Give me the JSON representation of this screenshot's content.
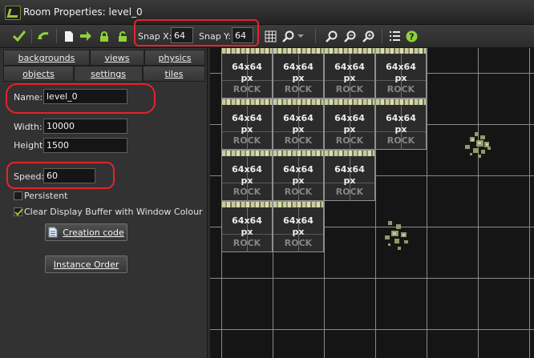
{
  "window": {
    "title": "Room Properties: level_0"
  },
  "toolbar": {
    "snap_x_label": "Snap X:",
    "snap_x_value": "64",
    "snap_y_label": "Snap Y:",
    "snap_y_value": "64"
  },
  "tabs": [
    {
      "label": "backgrounds"
    },
    {
      "label": "views"
    },
    {
      "label": "physics"
    },
    {
      "label": "objects"
    },
    {
      "label": "settings",
      "active": true
    },
    {
      "label": "tiles"
    }
  ],
  "settings": {
    "name_label": "Name:",
    "name_value": "level_0",
    "width_label": "Width:",
    "width_value": "10000",
    "height_label": "Height:",
    "height_value": "1500",
    "speed_label": "Speed:",
    "speed_value": "60",
    "persistent_label": "Persistent",
    "persistent_checked": false,
    "clear_display_label": "Clear Display Buffer with Window Colour",
    "clear_display_checked": true,
    "creation_code_label": "Creation code",
    "instance_order_label": "Instance Order"
  },
  "tile_label": {
    "line1": "64x64",
    "line2": "px",
    "line3": "ROCK"
  },
  "tile_rows": [
    4,
    4,
    3,
    2
  ],
  "colors": {
    "highlight": "#e3242b",
    "accent": "#9bc43a"
  }
}
